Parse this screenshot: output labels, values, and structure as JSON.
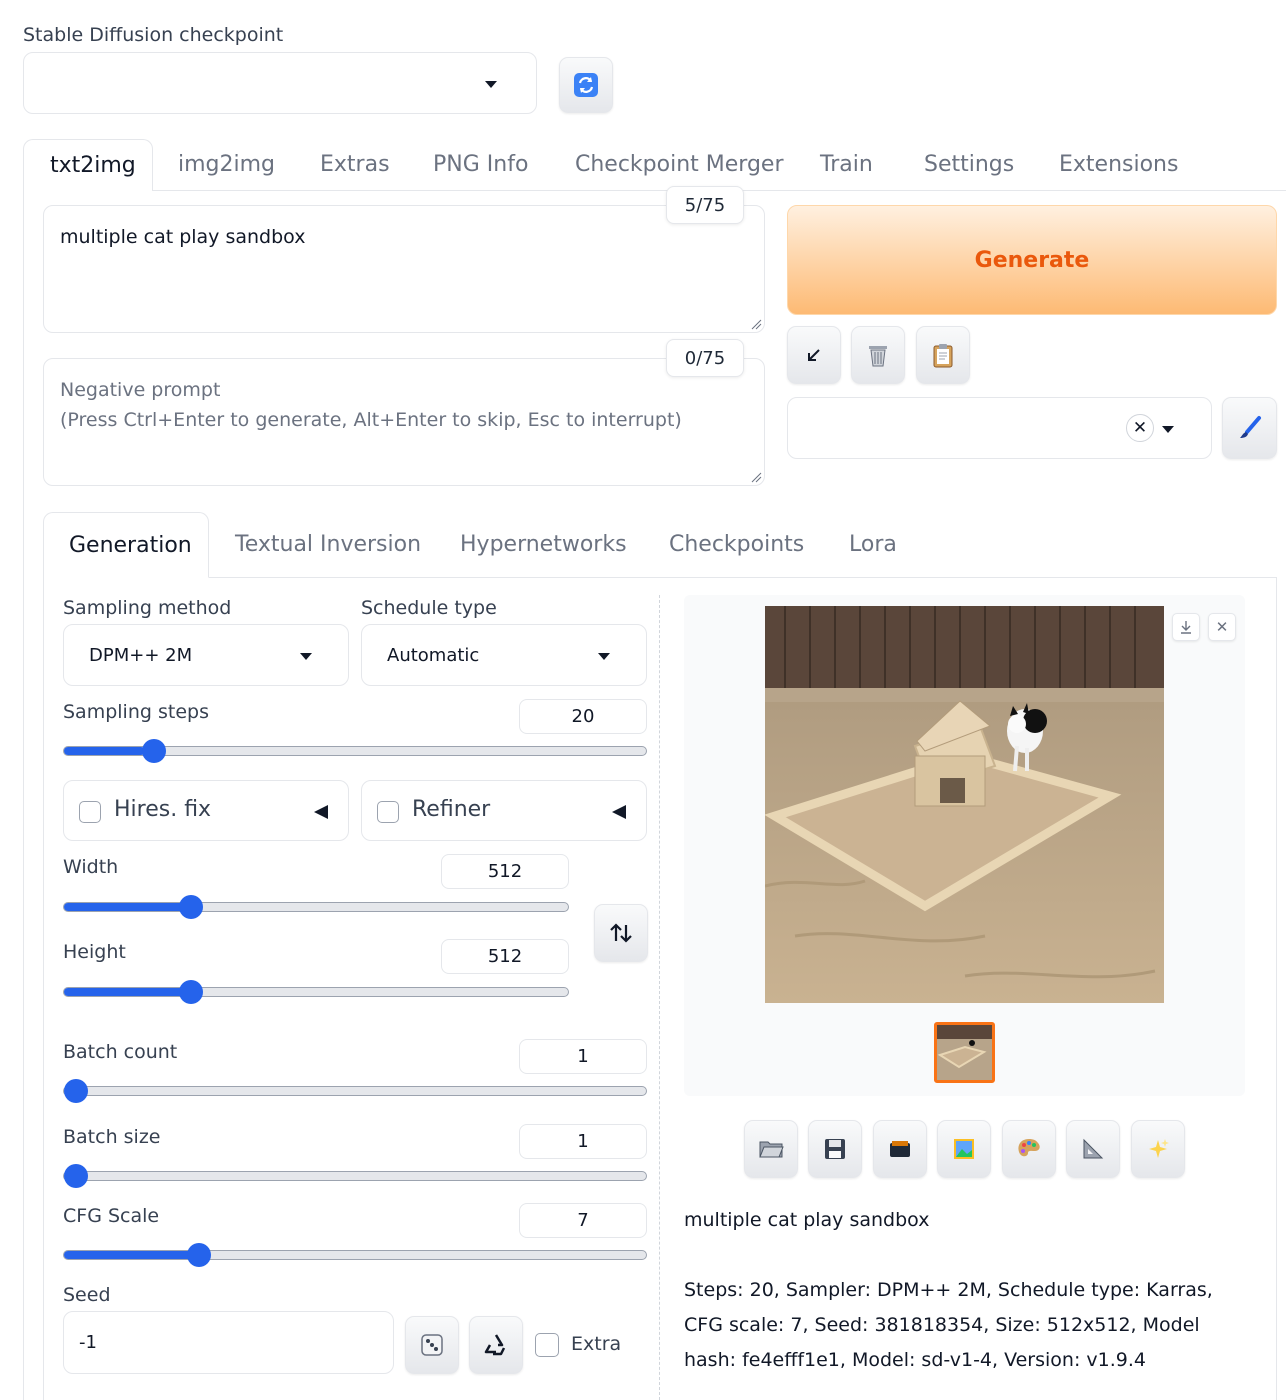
{
  "checkpoint": {
    "label": "Stable Diffusion checkpoint",
    "value": ""
  },
  "top_tabs": [
    "txt2img",
    "img2img",
    "Extras",
    "PNG Info",
    "Checkpoint Merger",
    "Train",
    "Settings",
    "Extensions"
  ],
  "prompt": {
    "value": "multiple cat play sandbox",
    "token_count": "5/75"
  },
  "negative_prompt": {
    "placeholder_line1": "Negative prompt",
    "placeholder_line2": "(Press Ctrl+Enter to generate, Alt+Enter to skip, Esc to interrupt)",
    "token_count": "0/75"
  },
  "generate_label": "Generate",
  "sub_tabs": [
    "Generation",
    "Textual Inversion",
    "Hypernetworks",
    "Checkpoints",
    "Lora"
  ],
  "sampling": {
    "method_label": "Sampling method",
    "method_value": "DPM++ 2M",
    "schedule_label": "Schedule type",
    "schedule_value": "Automatic",
    "steps_label": "Sampling steps",
    "steps_value": "20",
    "steps_fraction": 0.14
  },
  "hires_label": "Hires. fix",
  "refiner_label": "Refiner",
  "width": {
    "label": "Width",
    "value": "512",
    "fraction": 0.24
  },
  "height": {
    "label": "Height",
    "value": "512",
    "fraction": 0.24
  },
  "batch_count": {
    "label": "Batch count",
    "value": "1",
    "fraction": 0.0
  },
  "batch_size": {
    "label": "Batch size",
    "value": "1",
    "fraction": 0.0
  },
  "cfg": {
    "label": "CFG Scale",
    "value": "7",
    "fraction": 0.22
  },
  "seed": {
    "label": "Seed",
    "value": "-1",
    "extra_label": "Extra"
  },
  "output": {
    "prompt_text": "multiple cat play sandbox",
    "info_text": "Steps: 20, Sampler: DPM++ 2M, Schedule type: Karras, CFG scale: 7, Seed: 381818354, Size: 512x512, Model hash: fe4efff1e1, Model: sd-v1-4, Version: v1.9.4"
  },
  "colors": {
    "accent": "#2563eb",
    "generate_text": "#ea580c",
    "thumb_border": "#f97316"
  }
}
